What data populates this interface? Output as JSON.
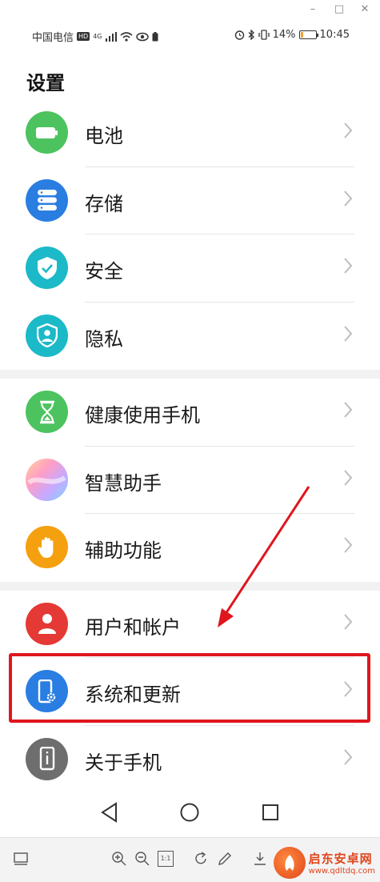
{
  "status_bar": {
    "carrier": "中国电信",
    "hd": "HD",
    "network": "4G",
    "battery_percent": "14%",
    "time": "10:45"
  },
  "page": {
    "title": "设置"
  },
  "groups": [
    {
      "items": [
        {
          "label": "电池",
          "icon": "battery-icon",
          "color": "#4cc35f"
        },
        {
          "label": "存储",
          "icon": "storage-icon",
          "color": "#2a7de1"
        },
        {
          "label": "安全",
          "icon": "shield-icon",
          "color": "#1cb9c8"
        },
        {
          "label": "隐私",
          "icon": "privacy-icon",
          "color": "#1cb9c8"
        }
      ]
    },
    {
      "items": [
        {
          "label": "健康使用手机",
          "icon": "hourglass-icon",
          "color": "#4cc35f"
        },
        {
          "label": "智慧助手",
          "icon": "assistant-icon",
          "color": "#c9a8ff"
        },
        {
          "label": "辅助功能",
          "icon": "hand-icon",
          "color": "#f5a00f"
        }
      ]
    },
    {
      "items": [
        {
          "label": "用户和帐户",
          "icon": "user-icon",
          "color": "#e53935"
        },
        {
          "label": "系统和更新",
          "icon": "system-update-icon",
          "color": "#2a7de1"
        },
        {
          "label": "关于手机",
          "icon": "phone-info-icon",
          "color": "#6e6e6e"
        }
      ]
    }
  ],
  "toolbar": {
    "zoom_ratio": "1:1"
  },
  "watermark": {
    "name": "启东安卓网",
    "url": "www.qdltdq.com"
  },
  "colors": {
    "highlight": "#e0161e",
    "divider": "#e6e6e6",
    "section_gap": "#f2f2f2"
  }
}
